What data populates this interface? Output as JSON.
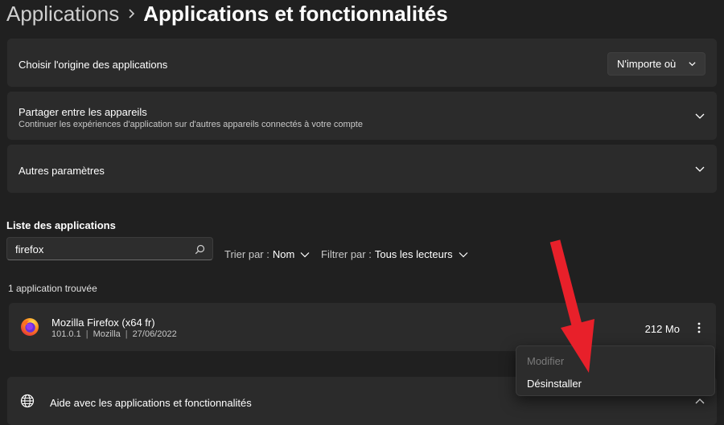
{
  "breadcrumb": {
    "parent": "Applications",
    "current": "Applications et fonctionnalités"
  },
  "settings": {
    "origin": {
      "label": "Choisir l'origine des applications",
      "dropdown_value": "N'importe où"
    },
    "share": {
      "label": "Partager entre les appareils",
      "description": "Continuer les expériences d'application sur d'autres appareils connectés à votre compte"
    },
    "other": {
      "label": "Autres paramètres"
    }
  },
  "app_list": {
    "heading": "Liste des applications",
    "search_value": "firefox",
    "sort_label": "Trier par :",
    "sort_value": "Nom",
    "filter_label": "Filtrer par :",
    "filter_value": "Tous les lecteurs",
    "result_count": "1 application trouvée",
    "apps": [
      {
        "name": "Mozilla Firefox (x64 fr)",
        "version": "101.0.1",
        "publisher": "Mozilla",
        "date": "27/06/2022",
        "size": "212 Mo",
        "icon": "firefox-icon"
      }
    ]
  },
  "context_menu": {
    "modify": "Modifier",
    "uninstall": "Désinstaller"
  },
  "help": {
    "label": "Aide avec les applications et fonctionnalités",
    "icon": "globe-icon"
  },
  "colors": {
    "background": "#202020",
    "card": "#2b2b2b",
    "annotation_arrow": "#e8202a"
  }
}
